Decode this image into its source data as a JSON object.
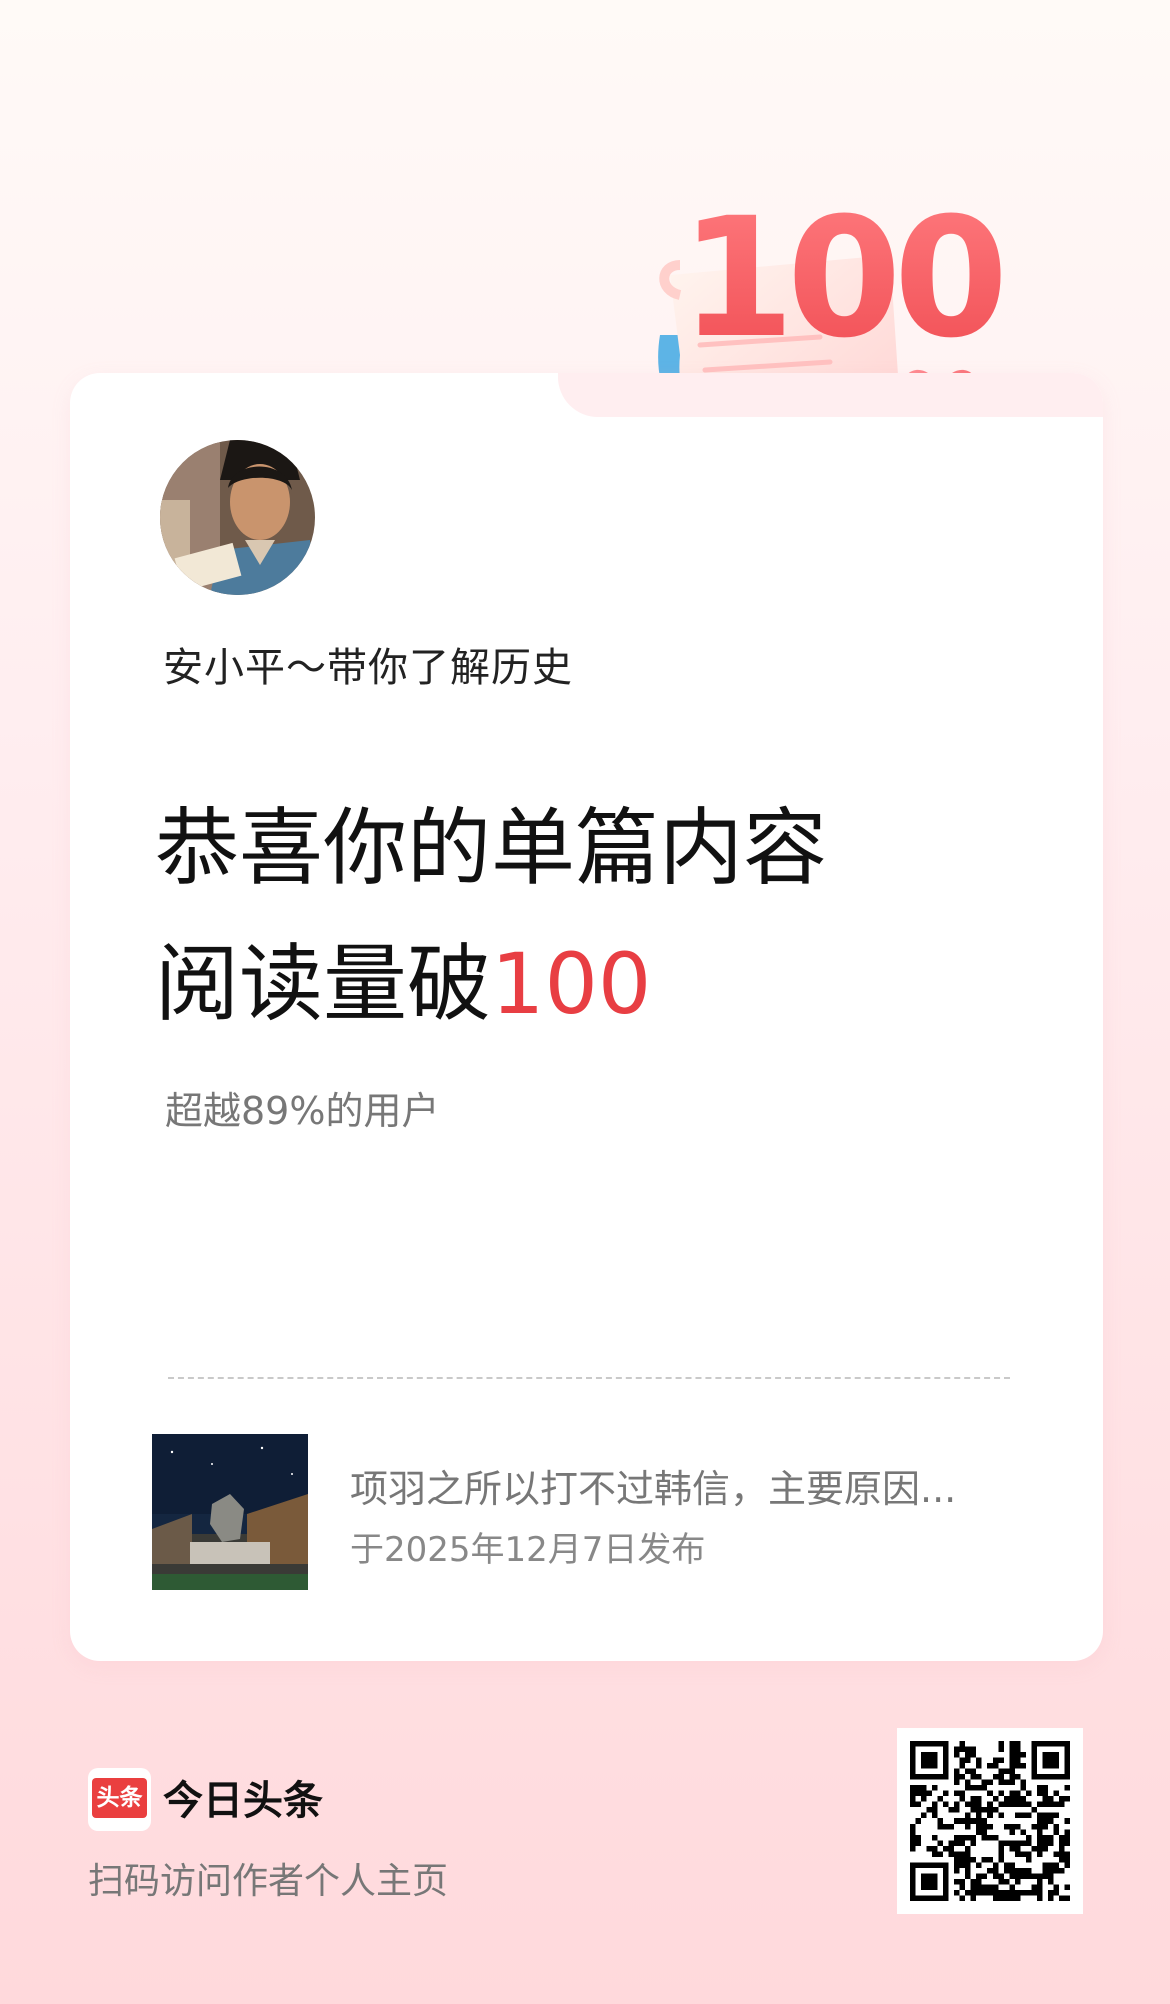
{
  "badge": {
    "number": "100",
    "heart_icon": "heart-icon"
  },
  "author": {
    "name": "安小平～带你了解历史"
  },
  "headline": {
    "line1": "恭喜你的单篇内容",
    "line2_prefix": "阅读量破",
    "line2_number": "100"
  },
  "stats": {
    "beat_text": "超越89%的用户"
  },
  "article": {
    "title": "项羽之所以打不过韩信，主要原因...",
    "date": "于2025年12月7日发布"
  },
  "footer": {
    "logo_mark": "头条",
    "app_name": "今日头条",
    "scan_hint": "扫码访问作者个人主页"
  },
  "colors": {
    "accent": "#e83e43",
    "background_top": "#fffaf7",
    "background_bottom": "#ffd9dc",
    "logo_red": "#ea3f3f"
  }
}
